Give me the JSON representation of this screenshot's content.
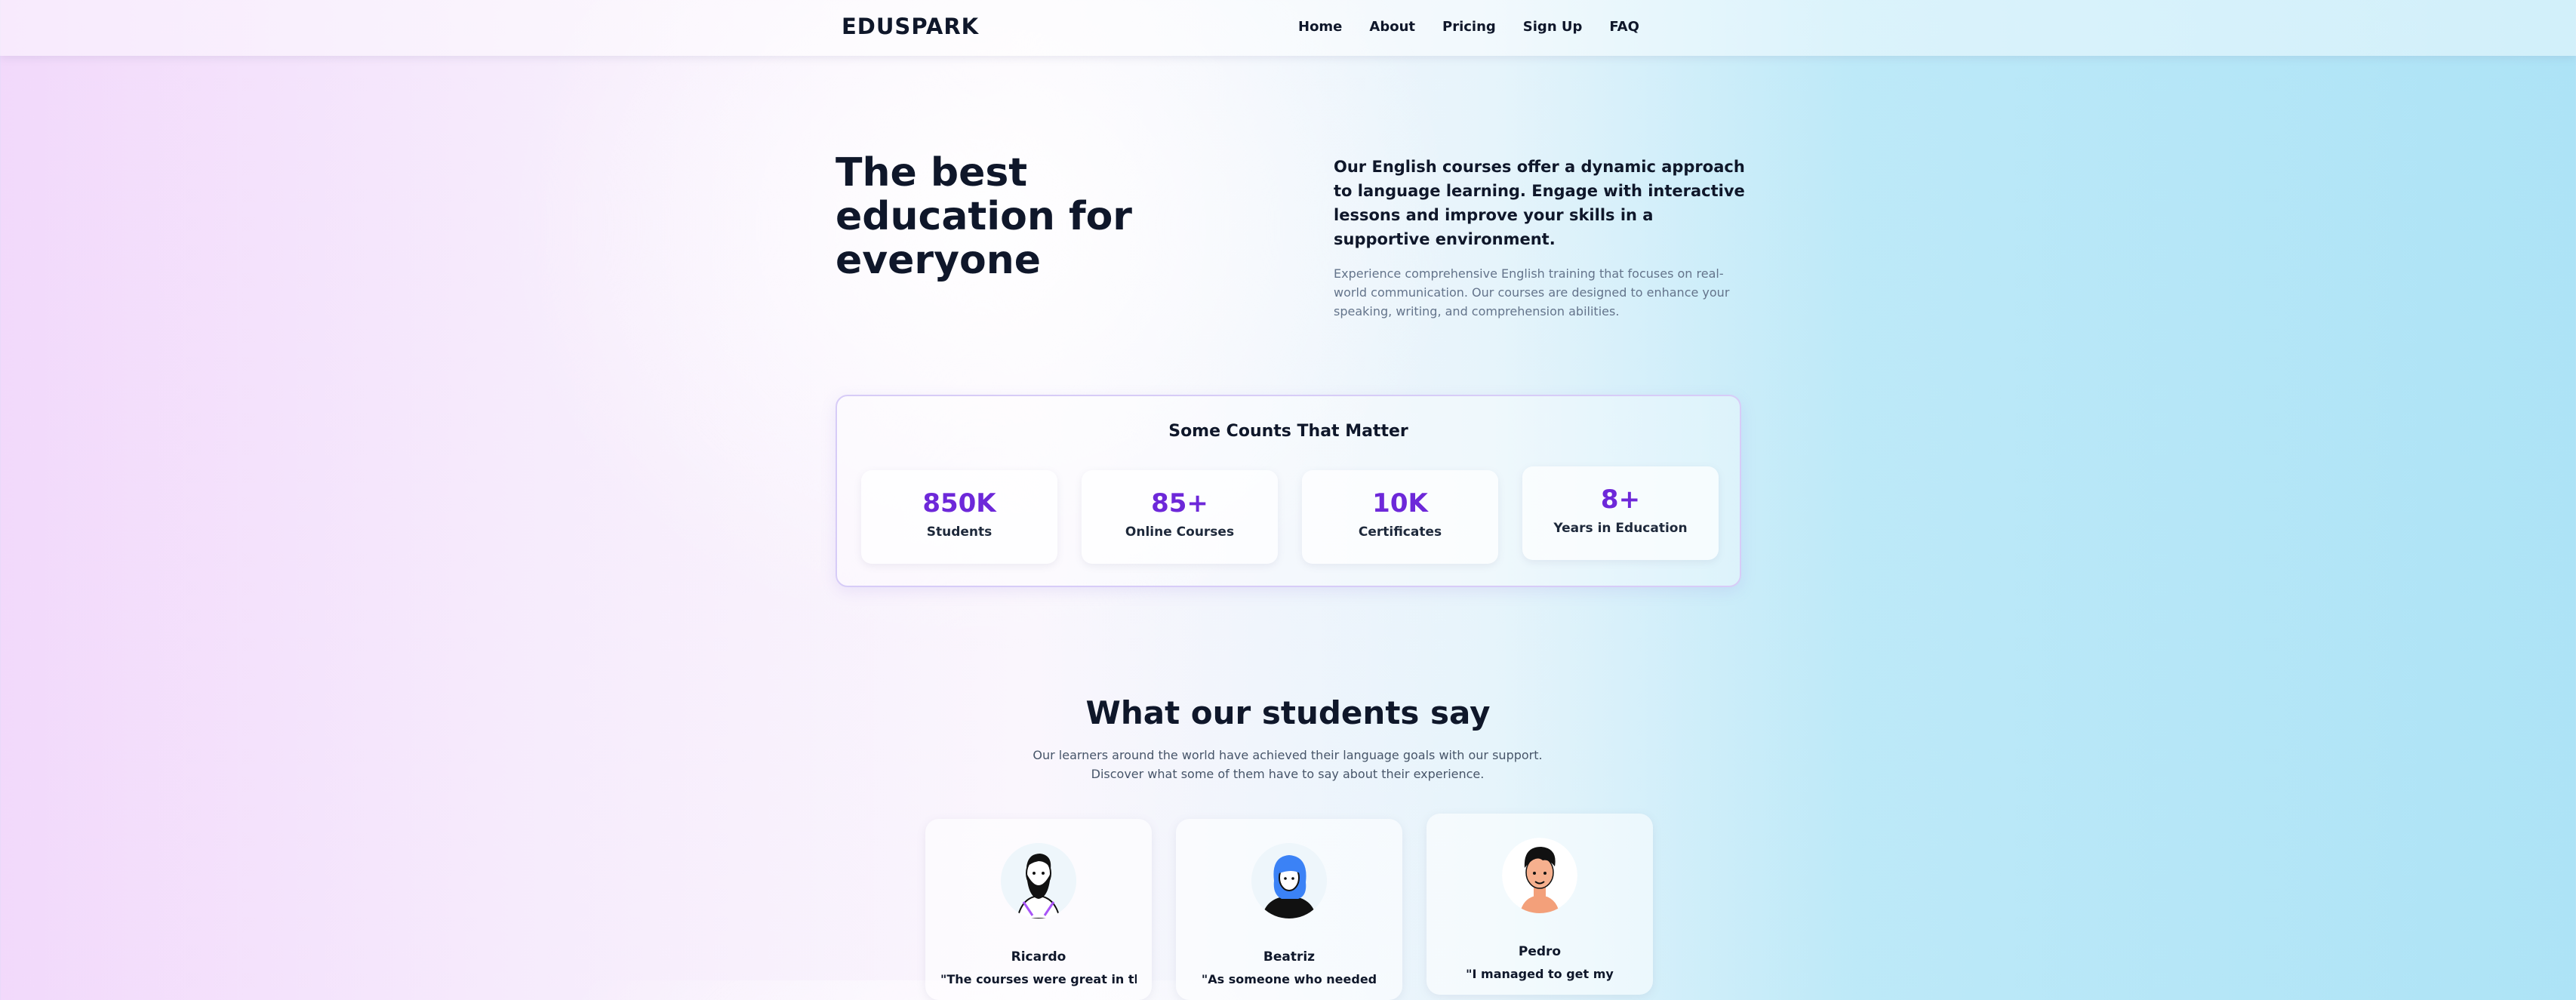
{
  "brand": "EDUSPARK",
  "nav": [
    "Home",
    "About",
    "Pricing",
    "Sign Up",
    "FAQ"
  ],
  "hero": {
    "title": "The best education for everyone",
    "lead": "Our English courses offer a dynamic approach to language learning. Engage with interactive lessons and improve your skills in a supportive environment.",
    "sub": "Experience comprehensive English training that focuses on real-world communication. Our courses are designed to enhance your speaking, writing, and comprehension abilities."
  },
  "stats": {
    "title": "Some Counts That Matter",
    "items": [
      {
        "value": "850K",
        "label": "Students"
      },
      {
        "value": "85+",
        "label": "Online Courses"
      },
      {
        "value": "10K",
        "label": "Certificates"
      },
      {
        "value": "8+",
        "label": "Years in Education"
      }
    ]
  },
  "testimonials": {
    "title": "What our students say",
    "subtitle": "Our learners around the world have achieved their language goals with our support. Discover what some of them have to say about their experience.",
    "cards": [
      {
        "name": "Ricardo",
        "quote": "\"The courses were great in th",
        "avatar": "bearded-man-avatar"
      },
      {
        "name": "Beatriz",
        "quote": "\"As someone who needed",
        "avatar": "woman-blue-hair-avatar"
      },
      {
        "name": "Pedro",
        "quote": "\"I managed to get my",
        "avatar": "young-man-avatar"
      }
    ]
  },
  "colors": {
    "accent": "#6d28d9",
    "text": "#0f172a",
    "muted": "#64748b"
  }
}
